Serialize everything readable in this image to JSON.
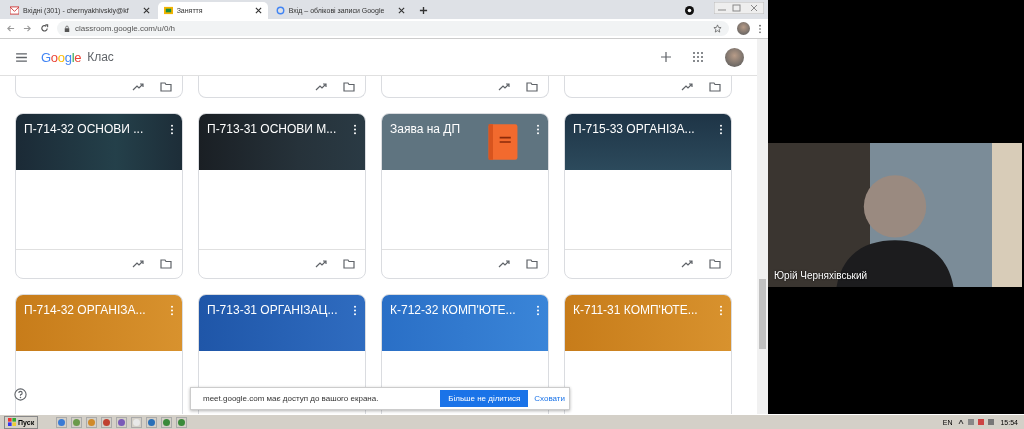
{
  "browser": {
    "tabs": [
      {
        "title": "Вхідні (301) - chernyakhivskiy@kf",
        "kind": "mail",
        "selected": false
      },
      {
        "title": "Заняття",
        "kind": "classroom",
        "selected": true
      },
      {
        "title": "Вхід – облікові записи Google",
        "kind": "google",
        "selected": false
      }
    ],
    "address": "classroom.google.com/u/0/h"
  },
  "app": {
    "logo": "Google",
    "product": "Клас"
  },
  "card_rows": [
    [
      {
        "title": "П-714-32 ОСНОВИ ...",
        "kind": "data"
      },
      {
        "title": "П-713-31 ОСНОВИ М...",
        "kind": "cisco"
      },
      {
        "title": "Заява на ДП",
        "kind": "book"
      },
      {
        "title": "П-715-33 ОРГАНІЗА...",
        "kind": "ocean"
      }
    ],
    [
      {
        "title": "П-714-32 ОРГАНІЗА...",
        "kind": "amber"
      },
      {
        "title": "П-713-31 ОРГАНІЗАЦ...",
        "kind": "blue"
      },
      {
        "title": "К-712-32 КОМП'ЮТЕ...",
        "kind": "sky"
      },
      {
        "title": "К-711-31 КОМП'ЮТЕ...",
        "kind": "amber"
      }
    ]
  ],
  "share_notice": {
    "text": "meet.google.com має доступ до вашого екрана.",
    "stop_button": "Більше не ділитися",
    "hide_link": "Сховати"
  },
  "video": {
    "name": "Юрій Черняхівський"
  },
  "taskbar": {
    "start": "Пуск",
    "language": "EN",
    "time": "15:54"
  }
}
